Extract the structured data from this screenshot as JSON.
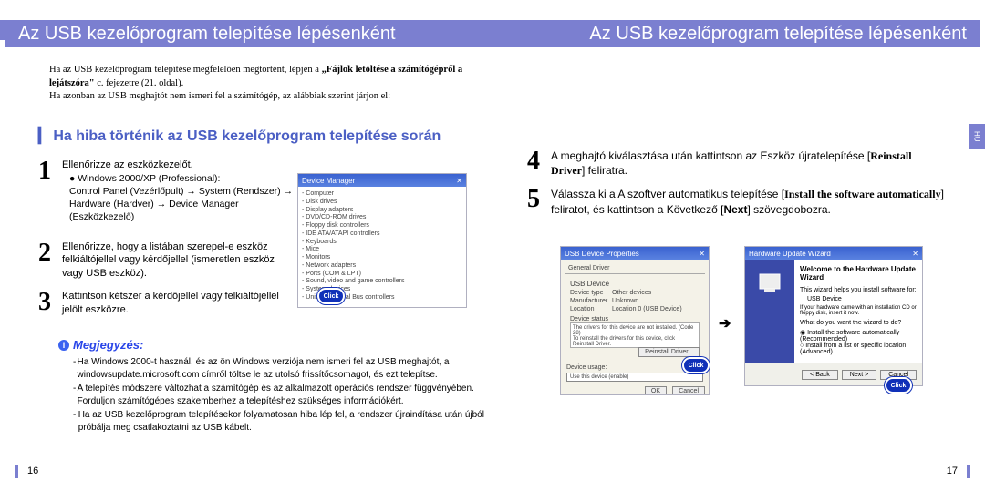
{
  "header": {
    "left_title": "Az USB kezelőprogram telepítése lépésenként",
    "right_title": "Az USB kezelőprogram telepítése lépésenként"
  },
  "side_tab": "HU",
  "intro": {
    "line1_a": "Ha az USB kezelőprogram telepítése megfelelően megtörtént, lépjen a ",
    "line1_b": "„Fájlok letöltése a számítógépről a lejátszóra\"",
    "line1_c": " c. fejezetre (21. oldal).",
    "line2": "Ha azonban az USB meghajtót nem ismeri fel a számítógép, az alábbiak szerint járjon el:"
  },
  "section_title": "Ha hiba történik az USB kezelőprogram telepítése során",
  "left_steps": [
    {
      "num": "1",
      "text": "Ellenőrizze az eszközkezelőt.",
      "sub": "● Windows 2000/XP (Professional):\nControl Panel (Vezérlőpult) → System (Rendszer) → Hardware (Hardver) → Device Manager (Eszközkezelő)"
    },
    {
      "num": "2",
      "text": "Ellenőrizze, hogy a listában szerepel-e eszköz felkiáltójellel vagy kérdőjellel (ismeretlen eszköz vagy USB eszköz)."
    },
    {
      "num": "3",
      "text": "Kattintson kétszer a kérdőjellel vagy felkiáltójellel jelölt eszközre."
    }
  ],
  "note_label": "Megjegyzés:",
  "notes": [
    "Ha Windows 2000-t használ, és az ön Windows verziója nem ismeri fel az USB meghajtót, a windowsupdate.microsoft.com címről töltse le az utolsó frissítőcsomagot, és ezt telepítse.",
    "A telepítés módszere változhat a számítógép és az alkalmazott operációs rendszer függvényében. Forduljon számítógépes szakemberhez a telepítéshez szükséges információkért.",
    "Ha az USB kezelőprogram telepítésekor folyamatosan hiba lép fel, a rendszer újraindítása után újból próbálja meg csatlakoztatni az USB kábelt."
  ],
  "right_steps": [
    {
      "num": "4",
      "pre": "A meghajtó kiválasztása után kattintson az Eszköz újratelepítése [",
      "bold": "Reinstall Driver",
      "post": "] feliratra."
    },
    {
      "num": "5",
      "parts": [
        "Válassza ki a A szoftver automatikus telepítése [",
        "Install the software automatically",
        "] feliratot, és kattintson a Következő [",
        "Next",
        "] szövegdobozra."
      ]
    }
  ],
  "click_label": "Click",
  "devmgr": {
    "title": "Device Manager",
    "items": [
      "- Computer",
      "- Disk drives",
      "- Display adapters",
      "- DVD/CD-ROM drives",
      "- Floppy disk controllers",
      "- IDE ATA/ATAPI controllers",
      "- Keyboards",
      "- Mice",
      "- Monitors",
      "- Network adapters",
      "- Ports (COM & LPT)",
      "- Sound, video and game controllers",
      "- System devices",
      "- Universal Serial Bus controllers"
    ]
  },
  "props": {
    "title": "USB Device Properties",
    "tabs": "General   Driver",
    "device_label": "USB Device",
    "rows": [
      {
        "k": "Device type",
        "v": "Other devices"
      },
      {
        "k": "Manufacturer",
        "v": "Unknown"
      },
      {
        "k": "Location",
        "v": "Location 0 (USB Device)"
      }
    ],
    "status_label": "Device status",
    "status_text": "The drivers for this device are not installed. (Code 28)\nTo reinstall the drivers for this device, click Reinstall Driver.",
    "reinstall_btn": "Reinstall Driver...",
    "usage_label": "Device usage:",
    "usage_value": "Use this device (enable)",
    "ok": "OK",
    "cancel": "Cancel"
  },
  "wizard": {
    "title": "Hardware Update Wizard",
    "welcome": "Welcome to the Hardware Update Wizard",
    "help": "This wizard helps you install software for:",
    "device": "USB Device",
    "cd_hint": "If your hardware came with an installation CD or floppy disk, insert it now.",
    "q": "What do you want the wizard to do?",
    "opt1": "Install the software automatically (Recommended)",
    "opt2": "Install from a list or specific location (Advanced)",
    "back": "< Back",
    "next": "Next >",
    "cancel": "Cancel"
  },
  "pages": {
    "left": "16",
    "right": "17"
  }
}
